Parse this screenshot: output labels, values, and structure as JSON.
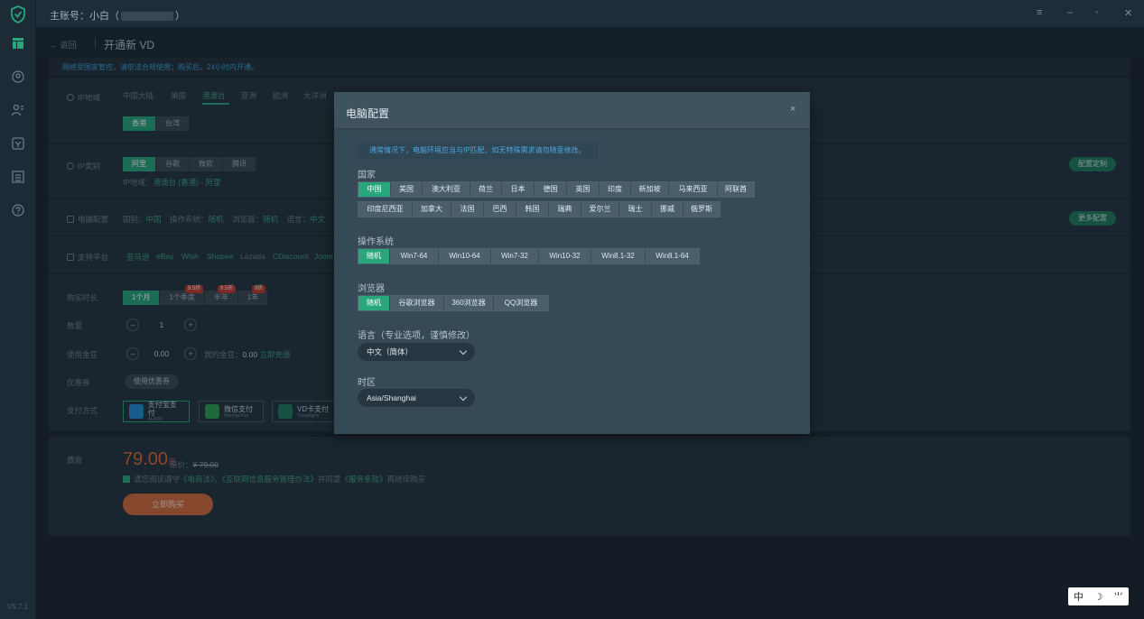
{
  "topbar": {
    "account_label": "主账号：小白（",
    "account_suffix": "）"
  },
  "window": {
    "menu": "≡",
    "minimize": "–",
    "restore": "▫",
    "close": "✕"
  },
  "header": {
    "back_label": "← 返回",
    "title": "开通新 VD"
  },
  "notice": "网络受国家管控，请依法合规使用；购买后，24小时内开通。",
  "version": "V5.7.1",
  "ip_region": {
    "label": "IP地域",
    "tabs": [
      "中国大陆",
      "美国",
      "港澳台",
      "亚洲",
      "欧洲",
      "大洋洲"
    ],
    "sub": [
      "香港",
      "台湾"
    ]
  },
  "ip_type": {
    "label": "IP类别",
    "options": [
      "阿里",
      "谷歌",
      "微软",
      "腾讯"
    ],
    "region_text": "IP地域：",
    "region_value": "港澳台 (香港) - 阿里",
    "custom_button": "配置定制"
  },
  "pc_config": {
    "label": "电脑配置",
    "country": "国别：",
    "country_value": "中国",
    "os": "操作系统：",
    "os_value": "随机",
    "browser": "浏览器：",
    "browser_value": "随机",
    "lang": "语言：",
    "lang_value": "中文",
    "more_button": "更多配置"
  },
  "platforms": {
    "label": "支持平台",
    "items": [
      "亚马逊",
      "eBay",
      "Wish",
      "Shopee",
      "Lazada",
      "CDiscount",
      "Joom"
    ]
  },
  "duration": {
    "label": "购买时长",
    "options": [
      "1个月",
      "1个季度",
      "半年",
      "1年"
    ],
    "badges": [
      "9.5折",
      "9.5折",
      "9折"
    ]
  },
  "quantity": {
    "label": "数量",
    "minus": "–",
    "value": "1",
    "plus": "+"
  },
  "balance": {
    "label": "使用金豆",
    "minus": "–",
    "value": "0.00",
    "plus": "+",
    "mine": "我的金豆：",
    "mine_value": "0.00",
    "recharge": "立即充值"
  },
  "coupon": {
    "label": "优惠券",
    "button": "使用优惠券"
  },
  "payment": {
    "label": "支付方式",
    "methods": [
      {
        "name": "支付宝支付",
        "sub": "ALIPAY"
      },
      {
        "name": "微信支付",
        "sub": "Wechat Pay"
      },
      {
        "name": "VD卡支付",
        "sub": "Yuanjingmi"
      }
    ]
  },
  "cost": {
    "label": "费用",
    "price": "79.00",
    "unit": "元",
    "orig_label": "原价：",
    "orig_value": "¥ 79.00",
    "agree_a": "请您阅读遵守",
    "agree_b": "《电商法》、《互联网信息服务管理办法》",
    "agree_c": "并同意",
    "agree_d": "《服务条款》",
    "agree_e": "再继续购买",
    "buy_button": "立即购买"
  },
  "modal": {
    "title": "电脑配置",
    "close": "×",
    "tip": "通常情况下，电脑环境应当与IP匹配，如无特殊需求请勿随意修改。",
    "country_label": "国家",
    "countries_row1": [
      "中国",
      "美国",
      "澳大利亚",
      "荷兰",
      "日本",
      "德国",
      "英国",
      "印度",
      "新加坡",
      "马来西亚",
      "阿联酋"
    ],
    "countries_row2": [
      "印度尼西亚",
      "加拿大",
      "法国",
      "巴西",
      "韩国",
      "瑞典",
      "爱尔兰",
      "瑞士",
      "挪威",
      "俄罗斯"
    ],
    "os_label": "操作系统",
    "os_options": [
      "随机",
      "Win7-64",
      "Win10-64",
      "Win7-32",
      "Win10-32",
      "Win8.1-32",
      "Win8.1-64"
    ],
    "browser_label": "浏览器",
    "browser_options": [
      "随机",
      "谷歌浏览器",
      "360浏览器",
      "QQ浏览器"
    ],
    "lang_label": "语言（专业选项，谨慎修改）",
    "lang_value": "中文（简体）",
    "tz_label": "时区",
    "tz_value": "Asia/Shanghai"
  },
  "ime": [
    "中",
    "☽",
    "⺌"
  ],
  "colors": {
    "accent": "#28a77d",
    "price": "#e0663a",
    "tip": "#4aa8e0"
  }
}
